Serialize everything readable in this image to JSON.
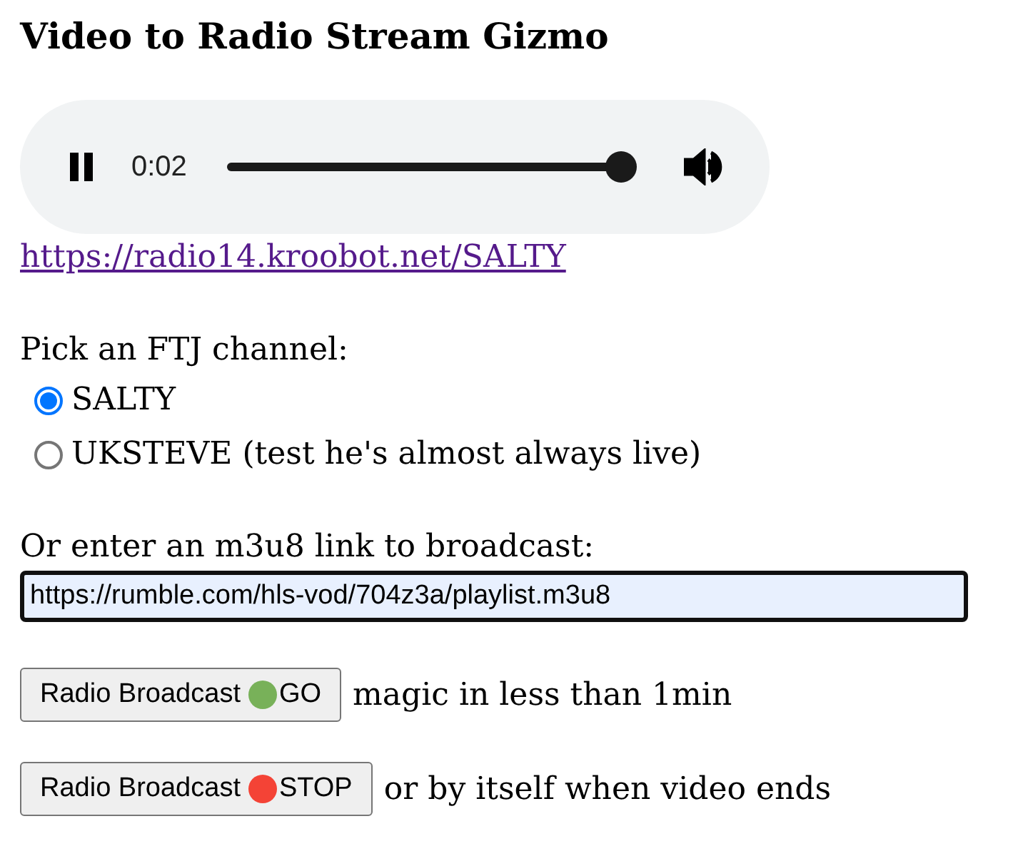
{
  "title": "Video to Radio Stream Gizmo",
  "player": {
    "playing": true,
    "time": "0:02",
    "level": 1
  },
  "stream_link": "https://radio14.kroobot.net/SALTY",
  "channel_picker": {
    "label": "Pick an FTJ channel:",
    "options": [
      {
        "label": "SALTY",
        "selected": true
      },
      {
        "label": "UKSTEVE (test he's almost always live)",
        "selected": false
      }
    ]
  },
  "m3u8_field": {
    "label": "Or enter an m3u8 link to broadcast:",
    "value": "https://rumble.com/hls-vod/704z3a/playlist.m3u8"
  },
  "actions": [
    {
      "label": "Radio Broadcast",
      "color": "#78b159",
      "action": "GO",
      "note": "magic in less than 1min"
    },
    {
      "label": "Radio Broadcast",
      "color": "#f44336",
      "action": "STOP",
      "note": "or by itself when video ends"
    }
  ]
}
